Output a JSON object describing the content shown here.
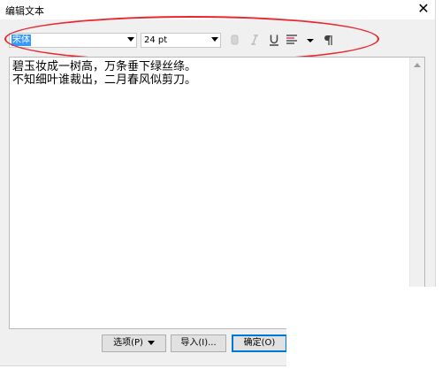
{
  "window": {
    "title": "编辑文本",
    "close_glyph": "✕"
  },
  "toolbar": {
    "font_value": "宋体",
    "size_value": "24 pt",
    "icons": [
      "bold-icon",
      "italic-icon",
      "underline-icon",
      "align-icon",
      "align-dropdown-icon",
      "paragraph-icon"
    ],
    "highlight_color": "#e8272f"
  },
  "editor": {
    "lines": [
      "碧玉妆成一树高，万条垂下绿丝绦。",
      "不知细叶谁裁出，二月春风似剪刀。"
    ]
  },
  "footer": {
    "options_label": "选项(P)",
    "import_label": "导入(I)...",
    "ok_label": "确定(O)"
  }
}
